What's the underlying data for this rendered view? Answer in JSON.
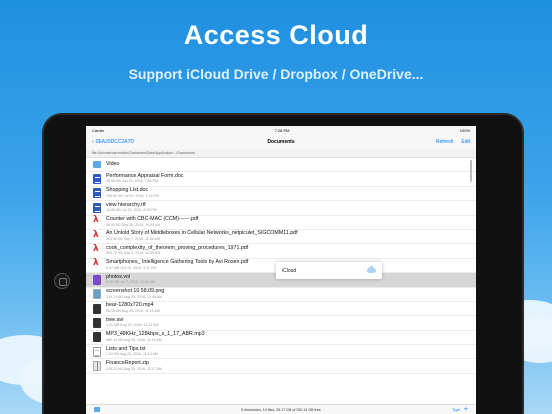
{
  "promo": {
    "headline": "Access Cloud",
    "subline": "Support iCloud Drive / Dropbox / OneDrive..."
  },
  "status": {
    "carrier": "Carrier",
    "time": "7:28 PM",
    "battery": "100%"
  },
  "nav": {
    "back_label": "0EA29DCC2A7D",
    "title": "Documents",
    "refresh_label": "Refresh",
    "edit_label": "Edit"
  },
  "path": "file:///private/var/mobile/Containers/Data/Application/.../Documents",
  "files": [
    {
      "icon": "folder",
      "name": "Video",
      "meta": ""
    },
    {
      "icon": "doc",
      "name": "Performance Appraisal Form.doc",
      "meta": "38.58 KB    Jun 22, 2016, 7:56 PM"
    },
    {
      "icon": "doc",
      "name": "Shopping List.doc",
      "meta": "768.50 KB    Jul 20, 2016, 7:13 PM"
    },
    {
      "icon": "doc",
      "name": "view hierarchy.rtf",
      "meta": "16.88 KB    Jul 19, 2016, 8:29 PM"
    },
    {
      "icon": "pdf",
      "name": "Counter with CBC-MAC (CCM)------.pdf",
      "meta": "99.53 KB    Sep 28, 2015, 10:55 AM"
    },
    {
      "icon": "pdf",
      "name": "An Untold Story of Middleboxes in Cellular Networks_netpiculet_SIGCOMM11.pdf",
      "meta": "304.35 KB    Sep 7, 2016, 11:06 AM"
    },
    {
      "icon": "pdf",
      "name": "cook_complexity_of_theorem_proving_procedures_1971.pdf",
      "meta": "503.72 KB    Sep 6, 2016, 10:58 AM"
    },
    {
      "icon": "pdf",
      "name": "Smartphones_ Intelligence Gathering Tools by Avi Rosen.pdf",
      "meta": "2.47 MB    Oct 25, 2015, 3:11 PM"
    },
    {
      "icon": "vol",
      "name": "photos.vol",
      "meta": "5.00 MB    Jul 7, 2016, 10:52 AM",
      "selected": true
    },
    {
      "icon": "img",
      "name": "screenshot 10.58.09.png",
      "meta": "139.74 KB    Aug 25, 2016, 10:58 AM"
    },
    {
      "icon": "vid",
      "name": "bear-1280x720.mp4",
      "meta": "56.95 KB    Aug 25, 2016, 11:15 AM"
    },
    {
      "icon": "vid",
      "name": "tree.avi",
      "meta": "1.41 MB    Aug 25, 2016, 11:13 AM"
    },
    {
      "icon": "vid",
      "name": "MP3_48KHz_128kbps_s_1_17_ABR.mp3",
      "meta": "480.44 KB    Aug 25, 2016, 11:16 AM"
    },
    {
      "icon": "txt",
      "name": "Lists and Tips.txt",
      "meta": "7.52 KB    Aug 25, 2016, 11:14 AM"
    },
    {
      "icon": "zip",
      "name": "FinanceReport.zip",
      "meta": "128.23 KB    Aug 25, 2016, 11:17 AM"
    }
  ],
  "toolbar": {
    "summary": "6 directories, 14 files, 25.17 GB of 250.14 GB free",
    "type_label": "Type",
    "plus_label": "+"
  },
  "popup": {
    "label": "iCloud"
  }
}
